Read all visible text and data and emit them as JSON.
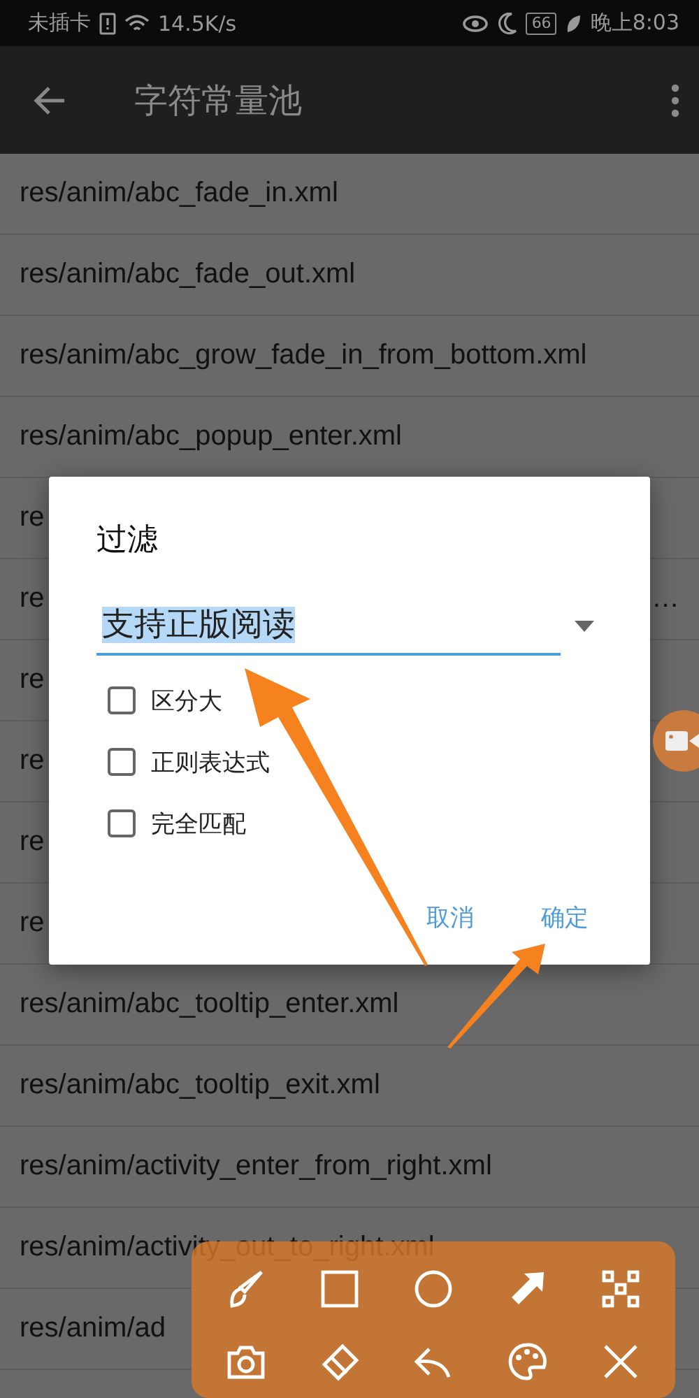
{
  "status_bar": {
    "carrier": "未插卡",
    "speed": "14.5K/s",
    "battery": "66",
    "time": "晚上8:03"
  },
  "app_bar": {
    "title": "字符常量池"
  },
  "list": {
    "rows": [
      {
        "text": "res/anim/abc_fade_in.xml"
      },
      {
        "text": "res/anim/abc_fade_out.xml"
      },
      {
        "text": "res/anim/abc_grow_fade_in_from_bottom.xml"
      },
      {
        "text": "res/anim/abc_popup_enter.xml"
      },
      {
        "text": "re"
      },
      {
        "text": "re",
        "tail": "…"
      },
      {
        "text": "re"
      },
      {
        "text": "re"
      },
      {
        "text": "re"
      },
      {
        "text": "re"
      },
      {
        "text": "res/anim/abc_tooltip_enter.xml"
      },
      {
        "text": "res/anim/abc_tooltip_exit.xml"
      },
      {
        "text": "res/anim/activity_enter_from_right.xml"
      },
      {
        "text": "res/anim/activity_out_to_right.xml"
      },
      {
        "text": "res/anim/ad"
      }
    ]
  },
  "dialog": {
    "title": "过滤",
    "field": {
      "value": "支持正版阅读",
      "highlighted": true
    },
    "options": [
      {
        "label": "区分大",
        "checked": false
      },
      {
        "label": "正则表达式",
        "checked": false
      },
      {
        "label": "完全匹配",
        "checked": false
      }
    ],
    "buttons": [
      "取消",
      "确定"
    ]
  }
}
